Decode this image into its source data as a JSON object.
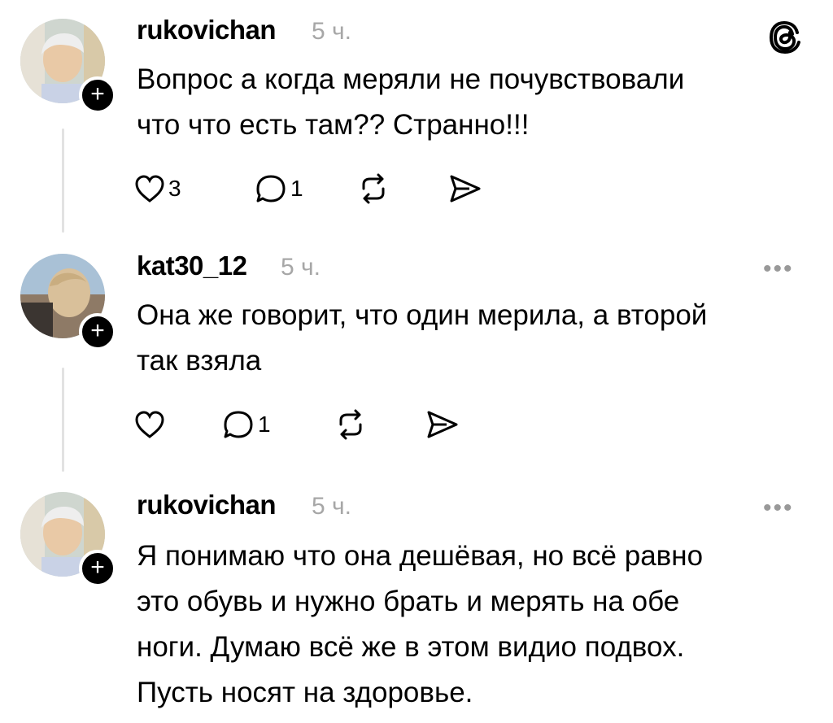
{
  "threads": {
    "logo_icon": "threads-logo-icon"
  },
  "posts": [
    {
      "username": "rukovichan",
      "time": "5 ч.",
      "text_lines": [
        "Вопрос а когда меряли не почувствовали",
        "что что есть там?? Странно!!!"
      ],
      "likes": "3",
      "replies": "1",
      "follow_label": "+"
    },
    {
      "username": "kat30_12",
      "time": "5 ч.",
      "text_lines": [
        "Она же говорит, что один мерила, а второй",
        "так взяла"
      ],
      "likes": "",
      "replies": "1",
      "follow_label": "+",
      "more_label": "•••"
    },
    {
      "username": "rukovichan",
      "time": "5 ч.",
      "text_lines": [
        "Я понимаю что она дешёвая, но всё равно",
        "это обувь и нужно брать и мерять на обе",
        "ноги. Думаю всё же в этом видио подвох.",
        "Пусть носят на здоровье."
      ],
      "follow_label": "+",
      "more_label": "•••"
    }
  ]
}
